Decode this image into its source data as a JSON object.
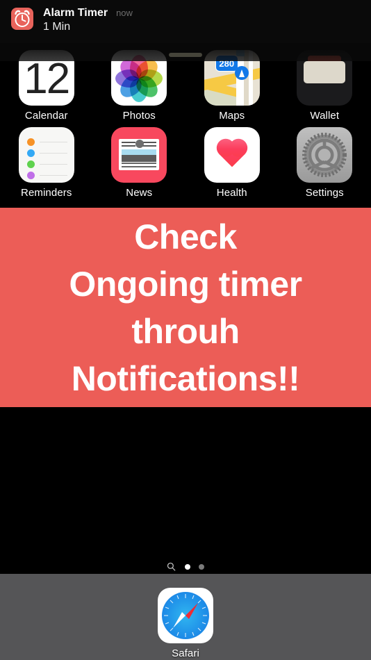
{
  "notification": {
    "icon": "alarm-clock-icon",
    "app_title": "Alarm Timer",
    "time": "now",
    "body": "1 Min"
  },
  "overlay": {
    "color": "#EC5D57",
    "lines": [
      "Check",
      "Ongoing timer",
      "throuh",
      "Notifications!!"
    ],
    "text": "Check Ongoing timer throuh Notifications!!"
  },
  "home": {
    "rows": [
      {
        "apps": [
          {
            "label": "Calendar",
            "icon": "calendar-icon",
            "day": "12"
          },
          {
            "label": "Photos",
            "icon": "photos-icon"
          },
          {
            "label": "Maps",
            "icon": "maps-icon",
            "shield": "280"
          },
          {
            "label": "Wallet",
            "icon": "wallet-icon"
          }
        ]
      },
      {
        "apps": [
          {
            "label": "Reminders",
            "icon": "reminders-icon"
          },
          {
            "label": "News",
            "icon": "news-icon"
          },
          {
            "label": "Health",
            "icon": "health-icon"
          },
          {
            "label": "Settings",
            "icon": "settings-icon"
          }
        ]
      }
    ]
  },
  "page_indicator": {
    "search_icon": "search-icon",
    "dots": [
      {
        "state": "active"
      },
      {
        "state": "inactive"
      }
    ]
  },
  "dock": {
    "background": "#555557",
    "apps": [
      {
        "label": "Safari",
        "icon": "safari-compass-icon"
      }
    ]
  }
}
